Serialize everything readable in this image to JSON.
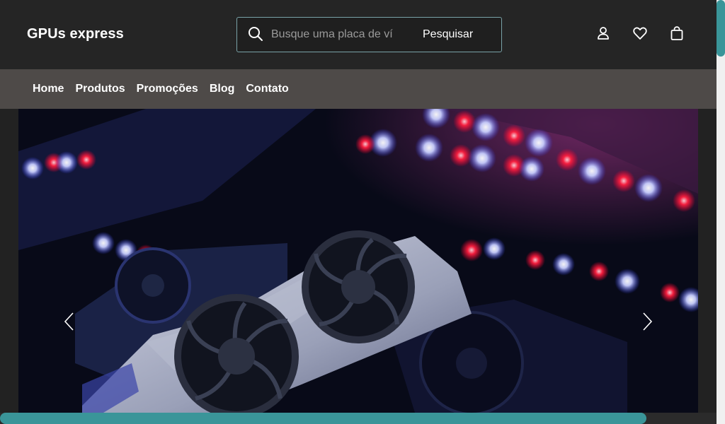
{
  "header": {
    "logo": "GPUs express",
    "search": {
      "placeholder": "Busque uma placa de vídeo",
      "value": "",
      "button_label": "Pesquisar",
      "icon": "search-icon"
    },
    "icons": [
      "user-icon",
      "heart-icon",
      "shopping-bag-icon"
    ]
  },
  "nav": {
    "items": [
      {
        "label": "Home"
      },
      {
        "label": "Produtos"
      },
      {
        "label": "Promoções"
      },
      {
        "label": "Blog"
      },
      {
        "label": "Contato"
      }
    ]
  },
  "hero": {
    "image": "graphics-card-with-led-lights",
    "prev_icon": "chevron-left-icon",
    "next_icon": "chevron-right-icon"
  },
  "colors": {
    "header_bg": "#252525",
    "nav_bg": "#4e4a48",
    "accent": "#3a9599",
    "search_border": "#7aa3a8"
  }
}
